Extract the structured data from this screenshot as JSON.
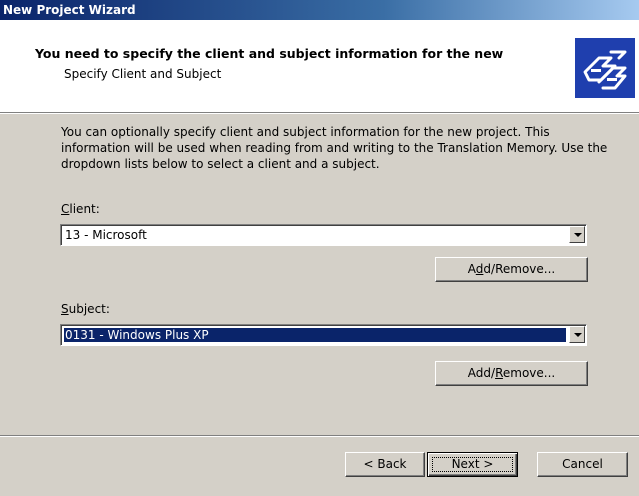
{
  "window": {
    "title": "New Project Wizard"
  },
  "header": {
    "heading": "You need to specify the client and subject information for the new",
    "subheading": "Specify Client and Subject",
    "icon": "wizard-hand-icon"
  },
  "intro": {
    "text": "You can optionally specify client and subject information for the new project. This information will be used when reading from and writing to the Translation Memory. Use the dropdown lists below to select a client and a subject."
  },
  "client": {
    "label_accel": "C",
    "label_rest": "lient:",
    "value": "13 - Microsoft",
    "button_pre": "A",
    "button_accel": "d",
    "button_post": "d/Remove..."
  },
  "subject": {
    "label_accel": "S",
    "label_rest": "ubject:",
    "value": "0131 - Windows Plus XP",
    "button_pre": "Add/",
    "button_accel": "R",
    "button_post": "emove..."
  },
  "footer": {
    "back_label": "< Back",
    "next_label": "Next >",
    "cancel_label": "Cancel"
  },
  "colors": {
    "title_bar": "#0a246a",
    "selection": "#0a246a",
    "dialog_face": "#d4d0c8",
    "icon_bg": "#1f3fae"
  }
}
